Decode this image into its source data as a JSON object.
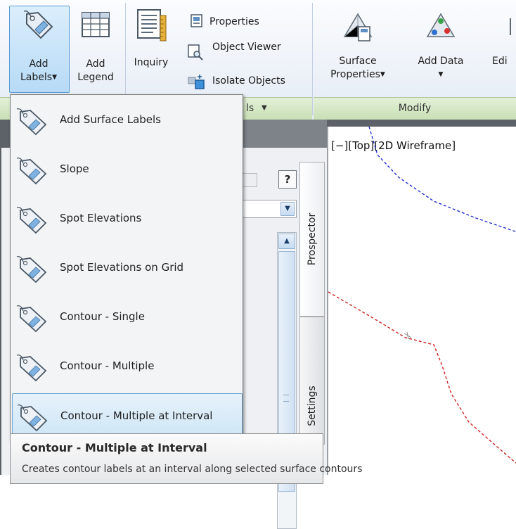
{
  "ribbon": {
    "add_labels": {
      "line1": "Add",
      "line2": "Labels"
    },
    "add_legend": {
      "line1": "Add",
      "line2": "Legend"
    },
    "inquiry": "Inquiry",
    "properties": "Properties",
    "object_viewer": "Object Viewer",
    "isolate_objects": "Isolate Objects",
    "surface_properties": {
      "line1": "Surface",
      "line2": "Properties"
    },
    "add_data": "Add Data",
    "edit_cut": "Edi",
    "groups": {
      "labels_partial": "ls",
      "modify": "Modify"
    }
  },
  "menu": {
    "items": [
      {
        "label": "Add Surface Labels",
        "icon": "tag-icon"
      },
      {
        "label": "Slope",
        "icon": "tag-icon"
      },
      {
        "label": "Spot Elevations",
        "icon": "tag-icon"
      },
      {
        "label": "Spot Elevations on Grid",
        "icon": "tag-icon"
      },
      {
        "label": "Contour - Single",
        "icon": "tag-icon"
      },
      {
        "label": "Contour - Multiple",
        "icon": "tag-icon"
      },
      {
        "label": "Contour - Multiple at Interval",
        "icon": "tag-icon",
        "selected": true
      }
    ]
  },
  "tooltip": {
    "title": "Contour - Multiple at Interval",
    "description": "Creates contour labels at an interval along selected surface contours"
  },
  "panel": {
    "help": "?",
    "tabs": {
      "prospector": "Prospector",
      "settings": "Settings"
    }
  },
  "viewport": {
    "label": "[−][Top][2D Wireframe]"
  },
  "colors": {
    "accent_blue": "#0000c8",
    "line_red": "#d02020",
    "selection": "#cde5f6"
  }
}
